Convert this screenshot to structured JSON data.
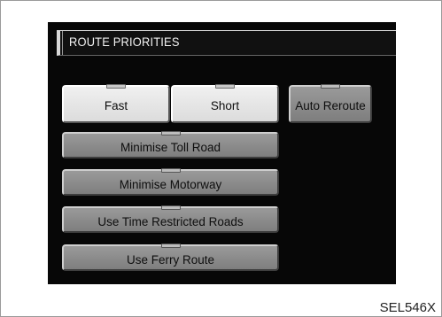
{
  "screen": {
    "title": "ROUTE PRIORITIES"
  },
  "buttons": {
    "fast": "Fast",
    "short": "Short",
    "auto_reroute": "Auto Reroute",
    "minimise_toll_road": "Minimise Toll Road",
    "minimise_motorway": "Minimise Motorway",
    "use_time_restricted_roads": "Use Time Restricted Roads",
    "use_ferry_route": "Use Ferry Route"
  },
  "states": {
    "fast_selected": true,
    "short_selected": true
  },
  "caption": "SEL546X"
}
